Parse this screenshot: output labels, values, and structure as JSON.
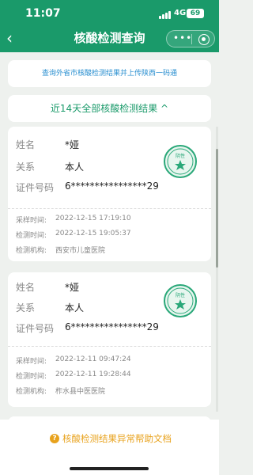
{
  "status_bar": {
    "time": "11:07",
    "network": "4G",
    "battery": "69"
  },
  "header": {
    "title": "核酸检测查询"
  },
  "link_card": {
    "text": "查询外省市核酸检测结果并上传陕西一码通"
  },
  "toggle_card": {
    "text": "近14天全部核酸检测结果 ^"
  },
  "labels": {
    "name": "姓名",
    "relation": "关系",
    "id_number": "证件号码",
    "sample_time": "采样时间:",
    "test_time": "检测时间:",
    "test_agency": "检测机构:"
  },
  "records": [
    {
      "name": "*娅",
      "relation": "本人",
      "id_number": "6****************29",
      "result": "阴性",
      "sample_time": "2022-12-15 17:19:10",
      "test_time": "2022-12-15 19:05:37",
      "test_agency": "西安市儿童医院"
    },
    {
      "name": "*娅",
      "relation": "本人",
      "id_number": "6****************29",
      "result": "阴性",
      "sample_time": "2022-12-11 09:47:24",
      "test_time": "2022-12-11 19:28:44",
      "test_agency": "柞水县中医医院"
    }
  ],
  "help": {
    "text": "核酸检测结果异常帮助文档",
    "icon": "?"
  },
  "colors": {
    "brand": "#1a9a6a",
    "link": "#2a8fd0",
    "warning": "#e8a21c"
  }
}
